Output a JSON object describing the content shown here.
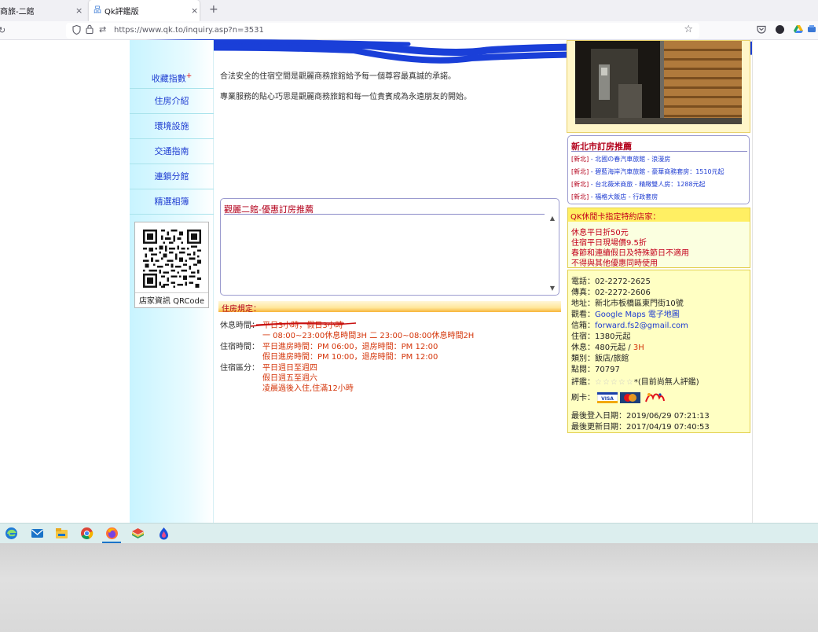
{
  "browser": {
    "tabs": [
      {
        "title": "商旅-二館",
        "close": "×"
      },
      {
        "title": "Qk評鑑版",
        "close": "×",
        "favicon": "qk-favicon-icon"
      }
    ],
    "new_tab": "+",
    "url": "https://www.qk.to/inquiry.asp?n=3531"
  },
  "sidebar": {
    "items": [
      {
        "label": "收藏指數",
        "badge": "+"
      },
      {
        "label": "住房介紹"
      },
      {
        "label": "環境設施"
      },
      {
        "label": "交通指南"
      },
      {
        "label": "連鎖分館"
      },
      {
        "label": "精選相簿"
      }
    ],
    "qr_caption": "店家資訊 QRCode"
  },
  "intro": {
    "line1": "合法安全的住宿空間是觀麗商務旅館給予每一個尊容最真誠的承諾。",
    "line2": "專業服務的貼心巧思是觀麗商務旅館和每一位貴賓成為永遠朋友的開始。"
  },
  "recommend": {
    "title": "觀麗二館-優惠訂房推薦"
  },
  "rules": {
    "title": "住房規定：",
    "rest_label": "休息時間：",
    "rest_line1": "平日3小時，假日3小時",
    "rest_line2": "一 08:00~23:00休息時間3H 二 23:00~08:00休息時間2H",
    "stay_label": "住宿時間：",
    "stay_line1": "平日進房時間：PM 06:00，退房時間：PM 12:00",
    "stay_line2": "假日進房時間：PM 10:00，退房時間：PM 12:00",
    "zone_label": "住宿區分：",
    "zone_line1": "平日週日至週四",
    "zone_line2": "假日週五至週六",
    "zone_line3": "凌晨過後入住,住滿12小時"
  },
  "region": {
    "title": "新北市訂房推薦",
    "items": [
      {
        "tag": "[新北]",
        "text": " - 北國の春汽車旅館 - 浪漫房"
      },
      {
        "tag": "[新北]",
        "text": " - 碧藍海岸汽車旅館 - 豪華商務套房：1510元起"
      },
      {
        "tag": "[新北]",
        "text": " - 台北薇米商旅 - 精緻雙人房：1288元起"
      },
      {
        "tag": "[新北]",
        "text": " - 福格大飯店 - 行政套房"
      }
    ]
  },
  "card": {
    "title": "QK休閒卡指定特約店家：",
    "lines": [
      "休息平日折50元",
      "住宿平日現場價9.5折",
      "春節和連續假日及特殊節日不適用",
      "不得與其他優惠同時使用"
    ]
  },
  "info": {
    "phone_label": "電話：",
    "phone": "02-2272-2625",
    "fax_label": "傳真：",
    "fax": "02-2272-2606",
    "address_label": "地址：",
    "address": "新北市板橋區東門街10號",
    "map_label": "觀看：",
    "map_link": "Google Maps 電子地圖",
    "email_label": "信箱：",
    "email": "forward.fs2@gmail.com",
    "stay_label": "住宿：",
    "stay": "1380元起",
    "rest_label": "休息：",
    "rest": "480元起 / ",
    "rest_hours": "3H",
    "category_label": "類別：",
    "category": "飯店/旅館",
    "views_label": "點閱：",
    "views": "70797",
    "rating_label": "評鑑：",
    "rating_stars": "☆☆☆☆☆",
    "rating_note": "*(目前尚無人評鑑)",
    "cards_label": "刷卡：",
    "card_visa": "VISA",
    "last_login": "最後登入日期：2019/06/29 07:21:13",
    "last_update": "最後更新日期：2017/04/19 07:40:53"
  },
  "colors": {
    "menu_link": "#1d3bd1",
    "heading_red": "#b3001b",
    "rule_orange": "#d4350a",
    "sidebar_cyan": "#c8f4ff",
    "info_yellow": "#ffffc3"
  }
}
